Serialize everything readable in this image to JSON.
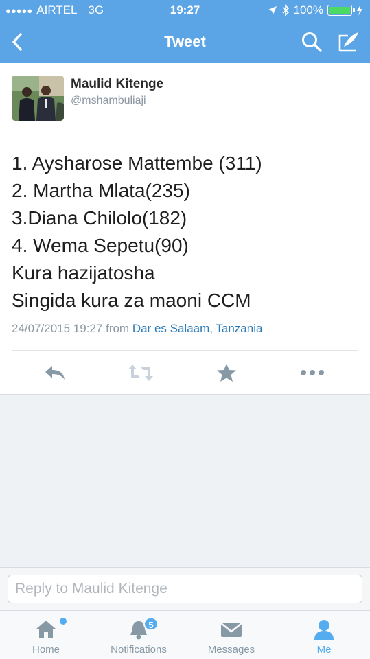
{
  "status_bar": {
    "signal_dots": "●●●●●",
    "carrier": "AIRTEL",
    "network": "3G",
    "time": "19:27",
    "battery_percent": "100%"
  },
  "nav": {
    "title": "Tweet",
    "back_icon": "chevron-left-icon",
    "search_icon": "search-icon",
    "compose_icon": "compose-icon"
  },
  "tweet": {
    "author_name": "Maulid Kitenge",
    "author_handle": "@mshambuliaji",
    "lines": [
      "1. Aysharose Mattembe (311)",
      "2. Martha Mlata(235)",
      "3.Diana Chilolo(182)",
      "4. Wema Sepetu(90)",
      "Kura hazijatosha",
      "Singida kura za maoni CCM"
    ],
    "timestamp": "24/07/2015 19:27",
    "from_label": "from",
    "location": "Dar es Salaam, Tanzania",
    "actions": [
      "reply-icon",
      "retweet-icon",
      "favorite-star-icon",
      "more-icon"
    ]
  },
  "reply": {
    "placeholder": "Reply to Maulid Kitenge"
  },
  "tabs": [
    {
      "label": "Home",
      "icon": "home-icon"
    },
    {
      "label": "Notifications",
      "icon": "bell-icon",
      "badge": "5"
    },
    {
      "label": "Messages",
      "icon": "envelope-icon"
    },
    {
      "label": "Me",
      "icon": "person-icon",
      "active": true
    }
  ],
  "colors": {
    "brand_blue": "#5ba5e6",
    "accent": "#55acee",
    "link": "#2b7bb9",
    "muted": "#8c97a3"
  }
}
